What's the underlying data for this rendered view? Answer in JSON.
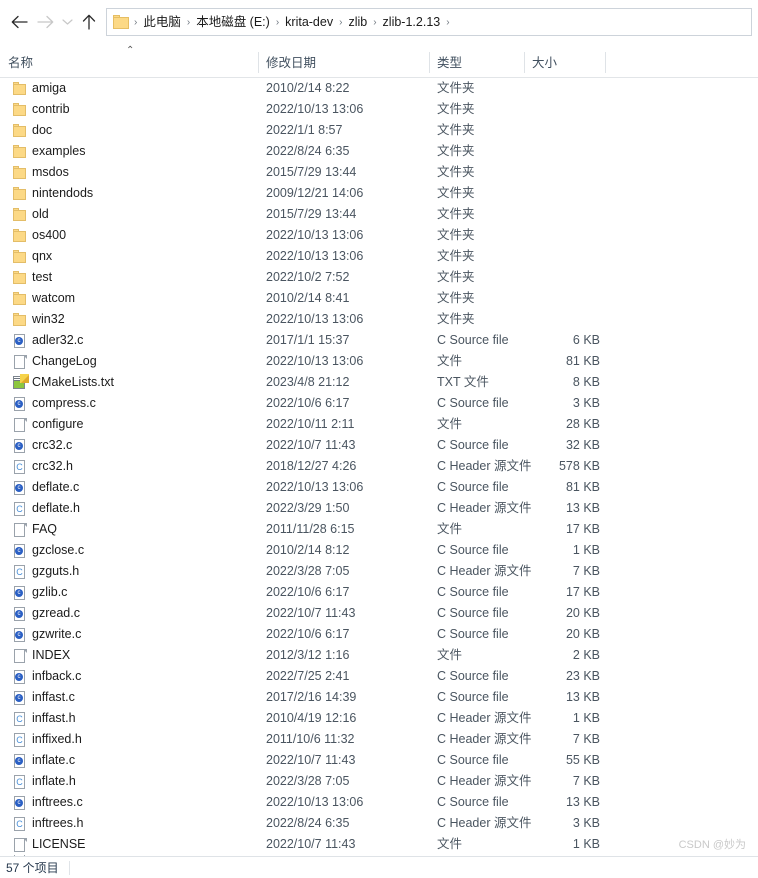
{
  "nav": {
    "back_label": "←",
    "forward_label": "→",
    "history_label": "⌄",
    "up_label": "↑",
    "folder_icon": "folder-icon"
  },
  "breadcrumb": {
    "separator": "›",
    "items": [
      "此电脑",
      "本地磁盘 (E:)",
      "krita-dev",
      "zlib",
      "zlib-1.2.13"
    ]
  },
  "columns": {
    "sort_caret": "⌃",
    "name": "名称",
    "date": "修改日期",
    "type": "类型",
    "size": "大小"
  },
  "files": [
    {
      "icon": "folder",
      "name": "amiga",
      "date": "2010/2/14 8:22",
      "type": "文件夹",
      "size": ""
    },
    {
      "icon": "folder",
      "name": "contrib",
      "date": "2022/10/13 13:06",
      "type": "文件夹",
      "size": ""
    },
    {
      "icon": "folder",
      "name": "doc",
      "date": "2022/1/1 8:57",
      "type": "文件夹",
      "size": ""
    },
    {
      "icon": "folder",
      "name": "examples",
      "date": "2022/8/24 6:35",
      "type": "文件夹",
      "size": ""
    },
    {
      "icon": "folder",
      "name": "msdos",
      "date": "2015/7/29 13:44",
      "type": "文件夹",
      "size": ""
    },
    {
      "icon": "folder",
      "name": "nintendods",
      "date": "2009/12/21 14:06",
      "type": "文件夹",
      "size": ""
    },
    {
      "icon": "folder",
      "name": "old",
      "date": "2015/7/29 13:44",
      "type": "文件夹",
      "size": ""
    },
    {
      "icon": "folder",
      "name": "os400",
      "date": "2022/10/13 13:06",
      "type": "文件夹",
      "size": ""
    },
    {
      "icon": "folder",
      "name": "qnx",
      "date": "2022/10/13 13:06",
      "type": "文件夹",
      "size": ""
    },
    {
      "icon": "folder",
      "name": "test",
      "date": "2022/10/2 7:52",
      "type": "文件夹",
      "size": ""
    },
    {
      "icon": "folder",
      "name": "watcom",
      "date": "2010/2/14 8:41",
      "type": "文件夹",
      "size": ""
    },
    {
      "icon": "folder",
      "name": "win32",
      "date": "2022/10/13 13:06",
      "type": "文件夹",
      "size": ""
    },
    {
      "icon": "c",
      "name": "adler32.c",
      "date": "2017/1/1 15:37",
      "type": "C Source file",
      "size": "6 KB"
    },
    {
      "icon": "doc",
      "name": "ChangeLog",
      "date": "2022/10/13 13:06",
      "type": "文件",
      "size": "81 KB"
    },
    {
      "icon": "txt",
      "name": "CMakeLists.txt",
      "date": "2023/4/8 21:12",
      "type": "TXT 文件",
      "size": "8 KB"
    },
    {
      "icon": "c",
      "name": "compress.c",
      "date": "2022/10/6 6:17",
      "type": "C Source file",
      "size": "3 KB"
    },
    {
      "icon": "doc",
      "name": "configure",
      "date": "2022/10/11 2:11",
      "type": "文件",
      "size": "28 KB"
    },
    {
      "icon": "c",
      "name": "crc32.c",
      "date": "2022/10/7 11:43",
      "type": "C Source file",
      "size": "32 KB"
    },
    {
      "icon": "h",
      "name": "crc32.h",
      "date": "2018/12/27 4:26",
      "type": "C Header 源文件",
      "size": "578 KB"
    },
    {
      "icon": "c",
      "name": "deflate.c",
      "date": "2022/10/13 13:06",
      "type": "C Source file",
      "size": "81 KB"
    },
    {
      "icon": "h",
      "name": "deflate.h",
      "date": "2022/3/29 1:50",
      "type": "C Header 源文件",
      "size": "13 KB"
    },
    {
      "icon": "doc",
      "name": "FAQ",
      "date": "2011/11/28 6:15",
      "type": "文件",
      "size": "17 KB"
    },
    {
      "icon": "c",
      "name": "gzclose.c",
      "date": "2010/2/14 8:12",
      "type": "C Source file",
      "size": "1 KB"
    },
    {
      "icon": "h",
      "name": "gzguts.h",
      "date": "2022/3/28 7:05",
      "type": "C Header 源文件",
      "size": "7 KB"
    },
    {
      "icon": "c",
      "name": "gzlib.c",
      "date": "2022/10/6 6:17",
      "type": "C Source file",
      "size": "17 KB"
    },
    {
      "icon": "c",
      "name": "gzread.c",
      "date": "2022/10/7 11:43",
      "type": "C Source file",
      "size": "20 KB"
    },
    {
      "icon": "c",
      "name": "gzwrite.c",
      "date": "2022/10/6 6:17",
      "type": "C Source file",
      "size": "20 KB"
    },
    {
      "icon": "doc",
      "name": "INDEX",
      "date": "2012/3/12 1:16",
      "type": "文件",
      "size": "2 KB"
    },
    {
      "icon": "c",
      "name": "infback.c",
      "date": "2022/7/25 2:41",
      "type": "C Source file",
      "size": "23 KB"
    },
    {
      "icon": "c",
      "name": "inffast.c",
      "date": "2017/2/16 14:39",
      "type": "C Source file",
      "size": "13 KB"
    },
    {
      "icon": "h",
      "name": "inffast.h",
      "date": "2010/4/19 12:16",
      "type": "C Header 源文件",
      "size": "1 KB"
    },
    {
      "icon": "h",
      "name": "inffixed.h",
      "date": "2011/10/6 11:32",
      "type": "C Header 源文件",
      "size": "7 KB"
    },
    {
      "icon": "c",
      "name": "inflate.c",
      "date": "2022/10/7 11:43",
      "type": "C Source file",
      "size": "55 KB"
    },
    {
      "icon": "h",
      "name": "inflate.h",
      "date": "2022/3/28 7:05",
      "type": "C Header 源文件",
      "size": "7 KB"
    },
    {
      "icon": "c",
      "name": "inftrees.c",
      "date": "2022/10/13 13:06",
      "type": "C Source file",
      "size": "13 KB"
    },
    {
      "icon": "h",
      "name": "inftrees.h",
      "date": "2022/8/24 6:35",
      "type": "C Header 源文件",
      "size": "3 KB"
    },
    {
      "icon": "doc",
      "name": "LICENSE",
      "date": "2022/10/7 11:43",
      "type": "文件",
      "size": "1 KB"
    }
  ],
  "status": {
    "items_count": "57 个项目"
  },
  "watermark": {
    "text": "CSDN @妙为"
  }
}
